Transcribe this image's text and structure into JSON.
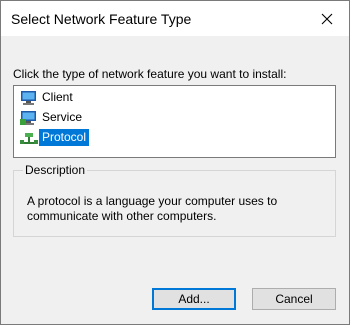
{
  "window": {
    "title": "Select Network Feature Type"
  },
  "instruction": "Click the type of network feature you want to install:",
  "features": [
    {
      "label": "Client",
      "icon": "client-computer-icon",
      "selected": false
    },
    {
      "label": "Service",
      "icon": "service-computer-icon",
      "selected": false
    },
    {
      "label": "Protocol",
      "icon": "protocol-network-icon",
      "selected": true
    }
  ],
  "description": {
    "caption": "Description",
    "text": "A protocol is a language your computer uses to communicate with other computers."
  },
  "buttons": {
    "add": "Add...",
    "cancel": "Cancel"
  },
  "colors": {
    "selection": "#0078d7",
    "dialog_bg": "#f0f0f0"
  }
}
